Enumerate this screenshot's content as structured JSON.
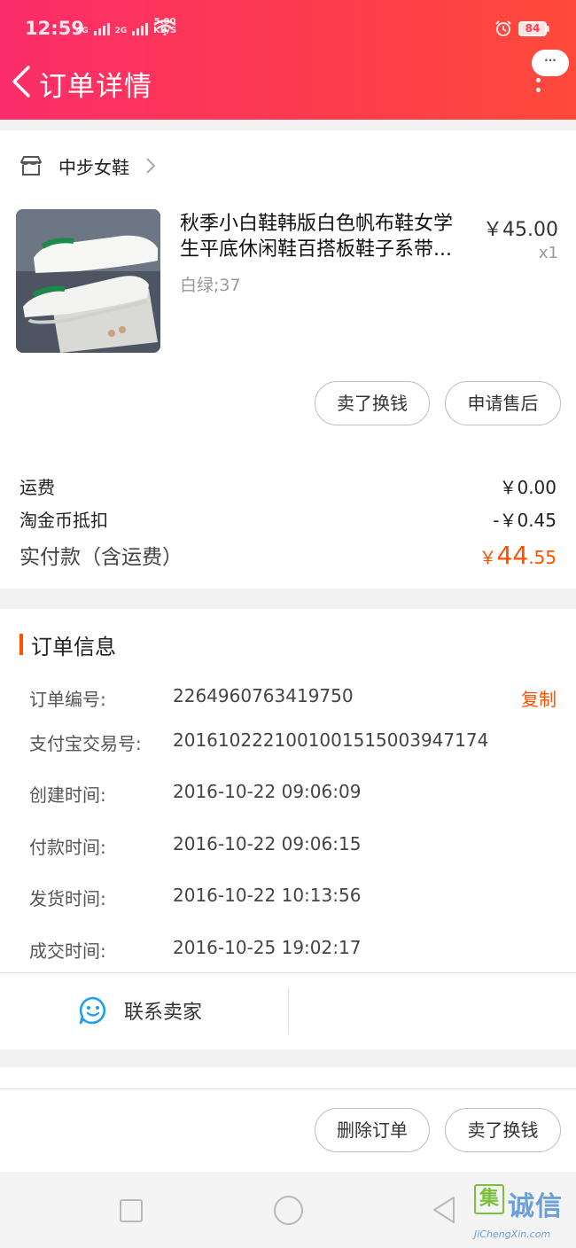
{
  "status_bar": {
    "time": "12:59",
    "net1": "4G",
    "net2": "2G",
    "speed_value": "5.00",
    "speed_unit": "KB/S",
    "battery": "84"
  },
  "header": {
    "title": "订单详情",
    "more_label": "···"
  },
  "shop": {
    "name": "中步女鞋"
  },
  "product": {
    "title": "秋季小白鞋韩版白色帆布鞋女学生平底休闲鞋百搭板鞋子系带...",
    "sku": "白绿;37",
    "price": "￥45.00",
    "qty": "x1"
  },
  "actions": {
    "sell": "卖了换钱",
    "after_sale": "申请售后"
  },
  "fees": {
    "shipping_label": "运费",
    "shipping_value": "￥0.00",
    "coin_label": "淘金币抵扣",
    "coin_value": "-￥0.45",
    "total_label": "实付款（含运费）",
    "total_currency": "￥",
    "total_int": "44",
    "total_dec": ".55"
  },
  "order_info": {
    "title": "订单信息",
    "copy_label": "复制",
    "rows": [
      {
        "key": "订单编号:",
        "value": "2264960763419750"
      },
      {
        "key": "支付宝交易号:",
        "value": "2016102221001001515003947174"
      },
      {
        "key": "创建时间:",
        "value": "2016-10-22 09:06:09"
      },
      {
        "key": "付款时间:",
        "value": "2016-10-22 09:06:15"
      },
      {
        "key": "发货时间:",
        "value": "2016-10-22 10:13:56"
      },
      {
        "key": "成交时间:",
        "value": "2016-10-25 19:02:17"
      }
    ],
    "contact_label": "联系卖家"
  },
  "bottom_actions": {
    "delete": "删除订单",
    "sell": "卖了换钱"
  },
  "watermark": {
    "mark": "集",
    "chars": "诚信",
    "url": "JiChengXin.com"
  },
  "colors": {
    "header_start": "#fb2d6a",
    "header_end": "#ff4a3a",
    "accent": "#ff5000"
  }
}
